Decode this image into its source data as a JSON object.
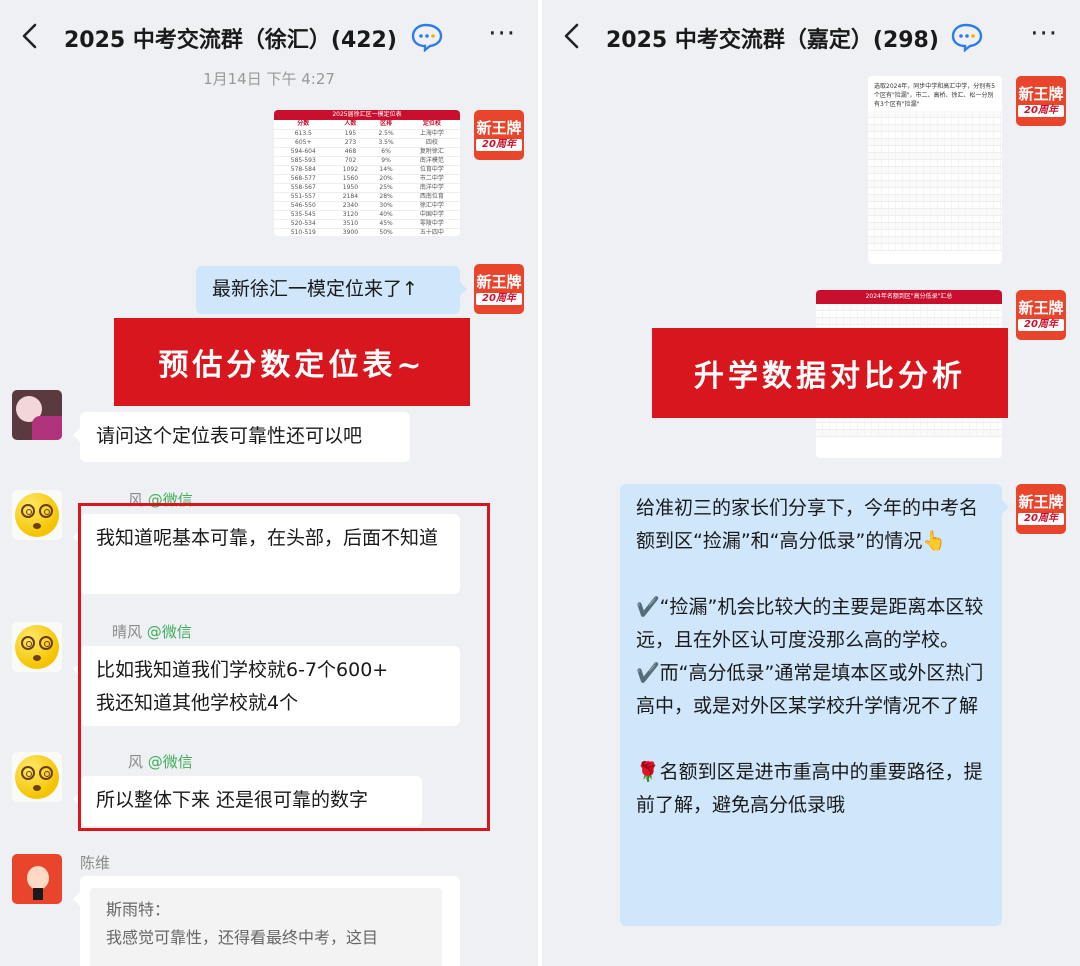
{
  "left": {
    "header": {
      "title": "2025 中考交流群（徐汇）(422)"
    },
    "timestamp": "1月14日 下午 4:27",
    "brand_avatar": {
      "line1": "新王牌",
      "line2": "20周年"
    },
    "image_table": {
      "title": "2025届徐汇区一模定位表",
      "headers": [
        "分数",
        "人数",
        "区排",
        "定位校"
      ],
      "rows": [
        [
          "613.5",
          "195",
          "2.5%",
          "上海中学"
        ],
        [
          "605+",
          "273",
          "3.5%",
          "四校"
        ],
        [
          "594-604",
          "468",
          "6%",
          "复附徐汇"
        ],
        [
          "585-593",
          "702",
          "9%",
          "南洋模范"
        ],
        [
          "578-584",
          "1092",
          "14%",
          "位育中学"
        ],
        [
          "568-577",
          "1560",
          "20%",
          "市二中学"
        ],
        [
          "558-567",
          "1950",
          "25%",
          "南洋中学"
        ],
        [
          "551-557",
          "2184",
          "28%",
          "西南位育"
        ],
        [
          "546-550",
          "2340",
          "30%",
          "徐汇中学"
        ],
        [
          "535-545",
          "3120",
          "40%",
          "中国中学"
        ],
        [
          "520-534",
          "3510",
          "45%",
          "零陵中学"
        ],
        [
          "510-519",
          "3900",
          "50%",
          "五十四中"
        ]
      ]
    },
    "msg_self": "最新徐汇一模定位来了↑",
    "banner": "预估分数定位表~",
    "msg_q": "请问这个定位表可靠性还可以吧",
    "wx_tag": "@微信",
    "sender1": "风",
    "msg_a1": "我知道呢基本可靠，在头部，后面不知道",
    "sender2": "晴风",
    "msg_a2a": "比如我知道我们学校就6-7个600+",
    "msg_a2b": "我还知道其他学校就4个",
    "sender3": "风",
    "msg_a3": "所以整体下来 还是很可靠的数字",
    "sender4": "陈维",
    "quote": {
      "author": "斯雨特：",
      "text": "我感觉可靠性，还得看最终中考，这目"
    }
  },
  "right": {
    "header": {
      "title": "2025 中考交流群（嘉定）(298)"
    },
    "img1_text": "选取2024年，同步中学和高汇中学，分别有5个区有\"捡漏\"，市二、高桥、徐汇、松一分别有3个区有\"捡漏\"",
    "img2_text": "2024年名额到区\"高分低录\"汇总",
    "banner": "升学数据对比分析",
    "msg_p1": "给准初三的家长们分享下，今年的中考名额到区“捡漏”和“高分低录”的情况👆",
    "msg_p2": "✔️“捡漏”机会比较大的主要是距离本区较远，且在外区认可度没那么高的学校。",
    "msg_p3": "✔️而“高分低录”通常是填本区或外区热门高中，或是对外区某学校升学情况不了解",
    "msg_p4": "🌹名额到区是进市重高中的重要路径，提前了解，避免高分低录哦"
  }
}
